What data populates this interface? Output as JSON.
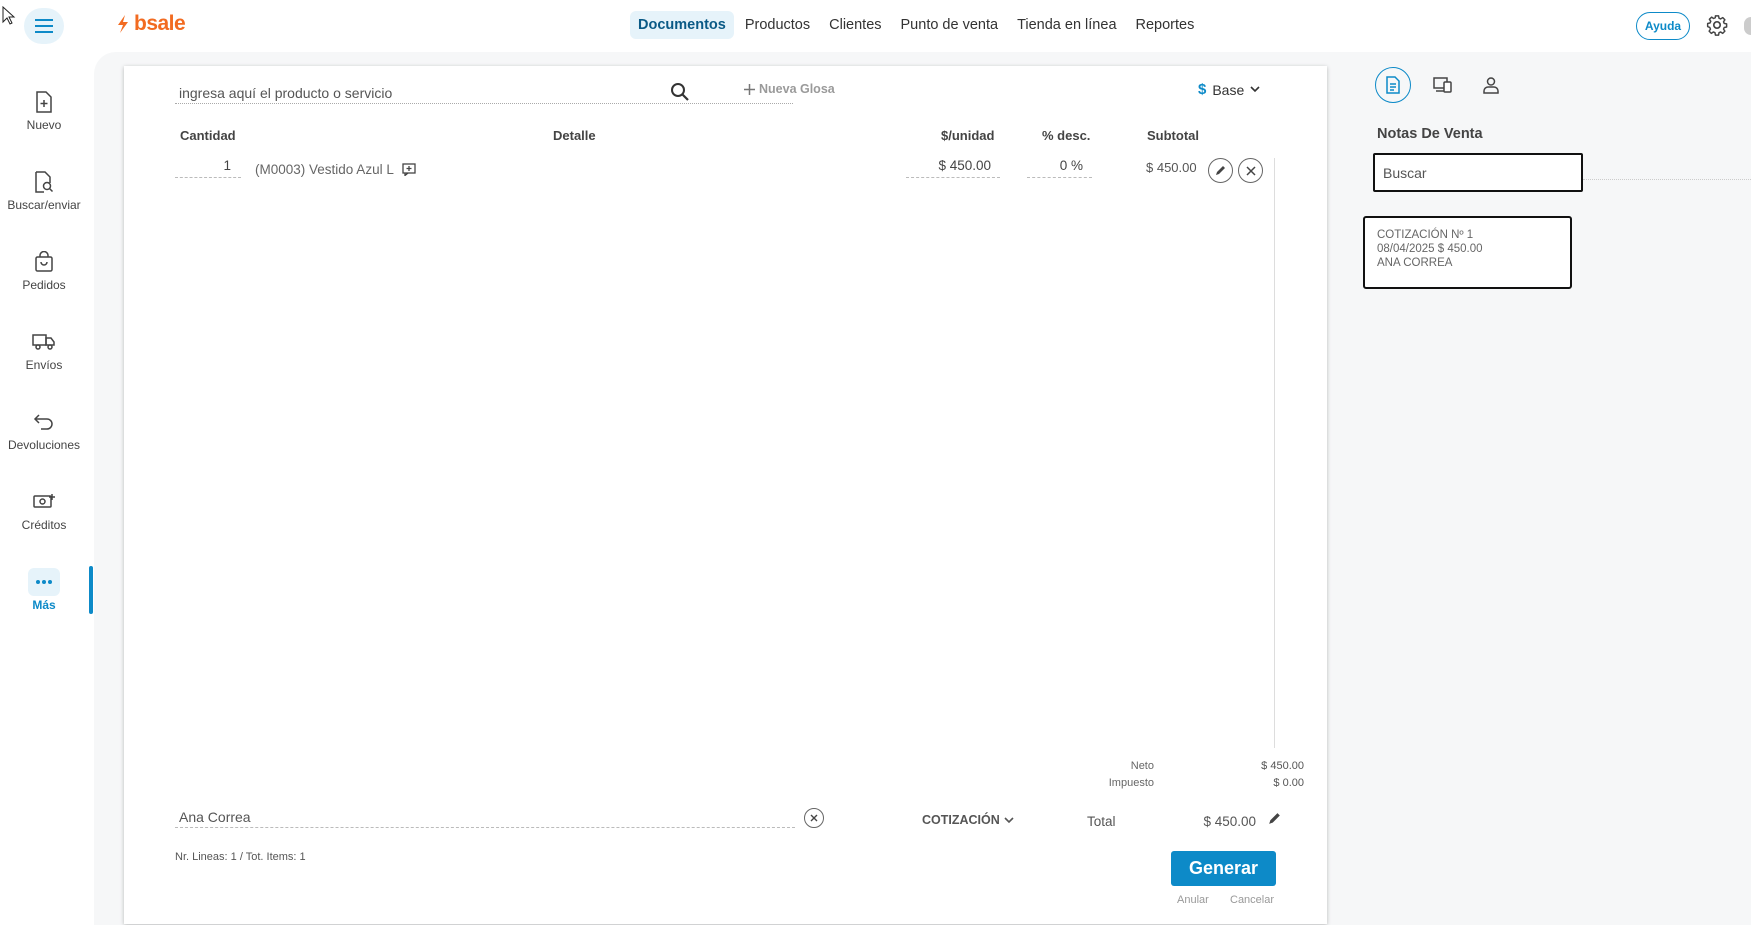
{
  "header": {
    "logo": "bsale",
    "nav": [
      {
        "label": "Documentos",
        "active": true
      },
      {
        "label": "Productos"
      },
      {
        "label": "Clientes"
      },
      {
        "label": "Punto de venta"
      },
      {
        "label": "Tienda en línea"
      },
      {
        "label": "Reportes"
      }
    ],
    "help_label": "Ayuda"
  },
  "sidebar": {
    "items": [
      {
        "label": "Nuevo",
        "icon": "file-plus-icon"
      },
      {
        "label": "Buscar/enviar",
        "icon": "file-search-icon"
      },
      {
        "label": "Pedidos",
        "icon": "bag-icon"
      },
      {
        "label": "Envíos",
        "icon": "truck-icon"
      },
      {
        "label": "Devoluciones",
        "icon": "return-icon"
      },
      {
        "label": "Créditos",
        "icon": "cash-plus-icon"
      },
      {
        "label": "Más",
        "icon": "more-icon",
        "active": true
      }
    ]
  },
  "document": {
    "search_placeholder": "ingresa aquí el producto o servicio",
    "nueva_glosa": "Nueva Glosa",
    "price_list": {
      "symbol": "$",
      "label": "Base"
    },
    "columns": {
      "cantidad": "Cantidad",
      "detalle": "Detalle",
      "unidad": "$/unidad",
      "desc": "% desc.",
      "subtotal": "Subtotal"
    },
    "lines": [
      {
        "qty": "1",
        "detail": "(M0003) Vestido Azul L",
        "unit_price": "$ 450.00",
        "discount": "0 %",
        "subtotal": "$ 450.00"
      }
    ],
    "totals": {
      "neto_label": "Neto",
      "neto": "$ 450.00",
      "impuesto_label": "Impuesto",
      "impuesto": "$ 0.00",
      "total_label": "Total",
      "total": "$ 450.00"
    },
    "client": "Ana Correa",
    "doc_type": "COTIZACIÓN",
    "lines_info": "Nr. Lineas: 1 / Tot. Items: 1",
    "generate_label": "Generar",
    "anular_label": "Anular",
    "cancelar_label": "Cancelar"
  },
  "right_panel": {
    "title": "Notas De Venta",
    "search_placeholder": "Buscar",
    "cards": [
      {
        "line1": "COTIZACIÓN Nº 1",
        "line2": "08/04/2025 $ 450.00",
        "line3": "ANA CORREA"
      }
    ]
  },
  "colors": {
    "accent": "#0d8ac8",
    "brand": "#f26b21",
    "active_bg": "#e6f3fa"
  }
}
